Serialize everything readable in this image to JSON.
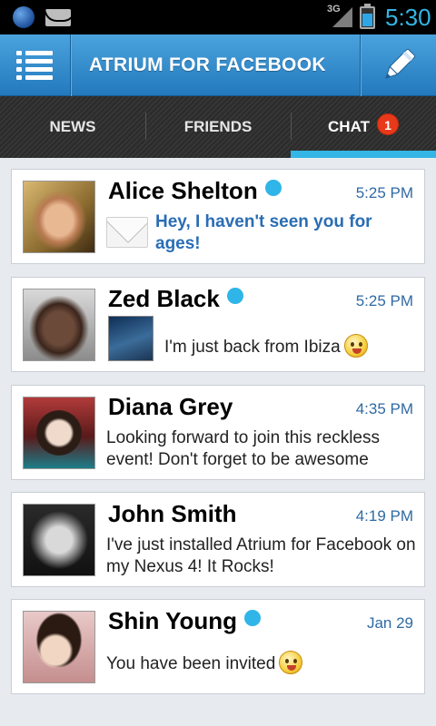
{
  "statusbar": {
    "network": "3G",
    "time": "5:30"
  },
  "appbar": {
    "title": "ATRIUM FOR FACEBOOK"
  },
  "tabs": [
    {
      "label": "NEWS",
      "selected": false
    },
    {
      "label": "FRIENDS",
      "selected": false
    },
    {
      "label": "CHAT",
      "selected": true,
      "badge": "1"
    }
  ],
  "colors": {
    "accent": "#33b5e5",
    "appbar": "#2f86cb",
    "badge": "#e8391a",
    "unread_text": "#2a6db5"
  },
  "conversations": [
    {
      "name": "Alice Shelton",
      "online": true,
      "time": "5:25 PM",
      "message": "Hey, I haven't seen you for ages!",
      "unread": true,
      "icon": "envelope-icon"
    },
    {
      "name": "Zed Black",
      "online": true,
      "time": "5:25 PM",
      "message": "I'm just back from Ibiza",
      "attachment": "photo-thumbnail",
      "icon": "smiley-tongue-emoji"
    },
    {
      "name": "Diana Grey",
      "online": false,
      "time": "4:35 PM",
      "message": "Looking forward to join this reckless event! Don't forget to be awesome"
    },
    {
      "name": "John Smith",
      "online": false,
      "time": "4:19 PM",
      "message": "I've just installed Atrium for Facebook on my Nexus 4! It Rocks!"
    },
    {
      "name": "Shin Young",
      "online": true,
      "time": "Jan 29",
      "message": "You have been invited",
      "icon": "smiley-wink-emoji"
    }
  ]
}
